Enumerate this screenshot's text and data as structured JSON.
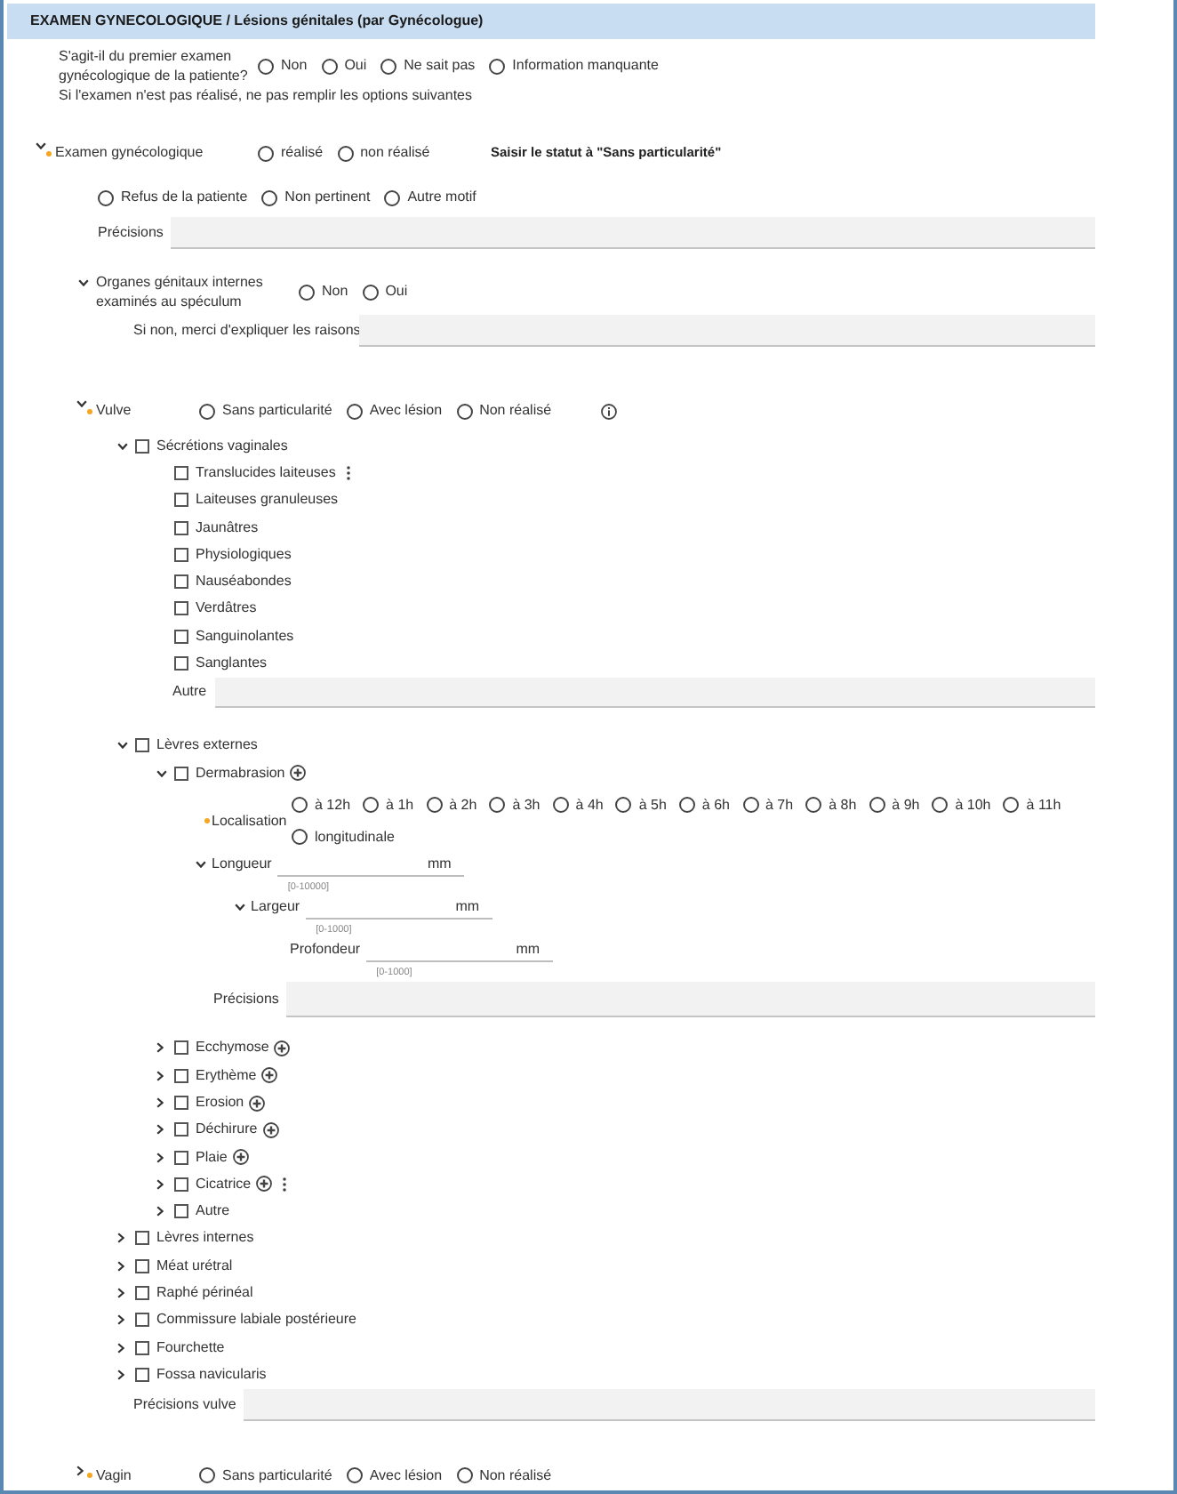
{
  "header": {
    "title": "EXAMEN GYNECOLOGIQUE / Lésions génitales (par Gynécologue)"
  },
  "first_exam": {
    "label_lines": [
      "S'agit-il du premier examen",
      "gynécologique de la patiente?"
    ],
    "options": [
      {
        "label": "Non",
        "selected": false
      },
      {
        "label": "Oui",
        "selected": false
      },
      {
        "label": "Ne sait pas",
        "selected": false
      },
      {
        "label": "Information manquante",
        "selected": false
      }
    ]
  },
  "instruction": "Si l'examen n'est pas réalisé, ne pas remplir les options suivantes",
  "exam": {
    "label": "Examen gynécologique",
    "expanded": true,
    "required": true,
    "options": [
      {
        "label": "réalisé",
        "selected": false
      },
      {
        "label": "non réalisé",
        "selected": false
      }
    ],
    "action": "Saisir le statut à \"Sans particularité\"",
    "reasons": [
      {
        "label": "Refus de la patiente",
        "selected": false
      },
      {
        "label": "Non pertinent",
        "selected": false
      },
      {
        "label": "Autre motif",
        "selected": false
      }
    ],
    "details": {
      "label": "Précisions"
    }
  },
  "speculum": {
    "label_lines": [
      "Organes génitaux internes",
      "examinés au spéculum"
    ],
    "expanded": true,
    "options": [
      {
        "label": "Non",
        "selected": false
      },
      {
        "label": "Oui",
        "selected": false
      }
    ],
    "explain": {
      "label": "Si non, merci d'expliquer les raisons"
    }
  },
  "vulve": {
    "label": "Vulve",
    "expanded": true,
    "required": true,
    "info": true,
    "options": [
      {
        "label": "Sans particularité",
        "selected": false
      },
      {
        "label": "Avec lésion",
        "selected": false
      },
      {
        "label": "Non réalisé",
        "selected": false
      }
    ],
    "children": [
      {
        "label": "Sécrétions vaginales",
        "checked": false,
        "expanded": true,
        "children": [
          {
            "label": "Translucides laiteuses",
            "checked": false,
            "menu": true
          },
          {
            "label": "Laiteuses granuleuses",
            "checked": false
          },
          {
            "label": "Jaunâtres",
            "checked": false
          },
          {
            "label": "Physiologiques",
            "checked": false
          },
          {
            "label": "Nauséabondes",
            "checked": false
          },
          {
            "label": "Verdâtres",
            "checked": false
          },
          {
            "label": "Sanguinolantes",
            "checked": false
          },
          {
            "label": "Sanglantes",
            "checked": false
          }
        ],
        "other": {
          "label": "Autre"
        }
      },
      {
        "label": "Lèvres externes",
        "checked": false,
        "expanded": true,
        "children": [
          {
            "label": "Dermabrasion",
            "checked": false,
            "expanded": true,
            "add": true,
            "details": {
              "localisation": {
                "label": "Localisation",
                "required": true,
                "options": [
                  {
                    "label": "à 12h",
                    "selected": false
                  },
                  {
                    "label": "à 1h",
                    "selected": false
                  },
                  {
                    "label": "à 2h",
                    "selected": false
                  },
                  {
                    "label": "à 3h",
                    "selected": false
                  },
                  {
                    "label": "à 4h",
                    "selected": false
                  },
                  {
                    "label": "à 5h",
                    "selected": false
                  },
                  {
                    "label": "à 6h",
                    "selected": false
                  },
                  {
                    "label": "à 7h",
                    "selected": false
                  },
                  {
                    "label": "à 8h",
                    "selected": false
                  },
                  {
                    "label": "à 9h",
                    "selected": false
                  },
                  {
                    "label": "à 10h",
                    "selected": false
                  },
                  {
                    "label": "à 11h",
                    "selected": false
                  },
                  {
                    "label": "longitudinale",
                    "selected": false
                  }
                ]
              },
              "measures": [
                {
                  "label": "Longueur",
                  "unit": "mm",
                  "range": "[0-10000]",
                  "expanded": true,
                  "children": [
                    {
                      "label": "Largeur",
                      "unit": "mm",
                      "range": "[0-1000]",
                      "expanded": true,
                      "children": [
                        {
                          "label": "Profondeur",
                          "unit": "mm",
                          "range": "[0-1000]"
                        }
                      ]
                    }
                  ]
                }
              ],
              "precisions": {
                "label": "Précisions"
              }
            }
          },
          {
            "label": "Ecchymose",
            "checked": false,
            "expanded": false,
            "add": true
          },
          {
            "label": "Erythème",
            "checked": false,
            "expanded": false,
            "add": true
          },
          {
            "label": "Erosion",
            "checked": false,
            "expanded": false,
            "add": true
          },
          {
            "label": "Déchirure",
            "checked": false,
            "expanded": false,
            "add": true
          },
          {
            "label": "Plaie",
            "checked": false,
            "expanded": false,
            "add": true
          },
          {
            "label": "Cicatrice",
            "checked": false,
            "expanded": false,
            "add": true,
            "menu": true
          },
          {
            "label": "Autre",
            "checked": false,
            "expanded": false
          }
        ]
      },
      {
        "label": "Lèvres internes",
        "checked": false,
        "expanded": false
      },
      {
        "label": "Méat urétral",
        "checked": false,
        "expanded": false
      },
      {
        "label": "Raphé périnéal",
        "checked": false,
        "expanded": false
      },
      {
        "label": "Commissure labiale postérieure",
        "checked": false,
        "expanded": false
      },
      {
        "label": "Fourchette",
        "checked": false,
        "expanded": false
      },
      {
        "label": "Fossa navicularis",
        "checked": false,
        "expanded": false
      }
    ],
    "details": {
      "label": "Précisions vulve"
    }
  },
  "vagin": {
    "label": "Vagin",
    "expanded": false,
    "required": true,
    "options": [
      {
        "label": "Sans particularité",
        "selected": false
      },
      {
        "label": "Avec lésion",
        "selected": false
      },
      {
        "label": "Non réalisé",
        "selected": false
      }
    ]
  }
}
